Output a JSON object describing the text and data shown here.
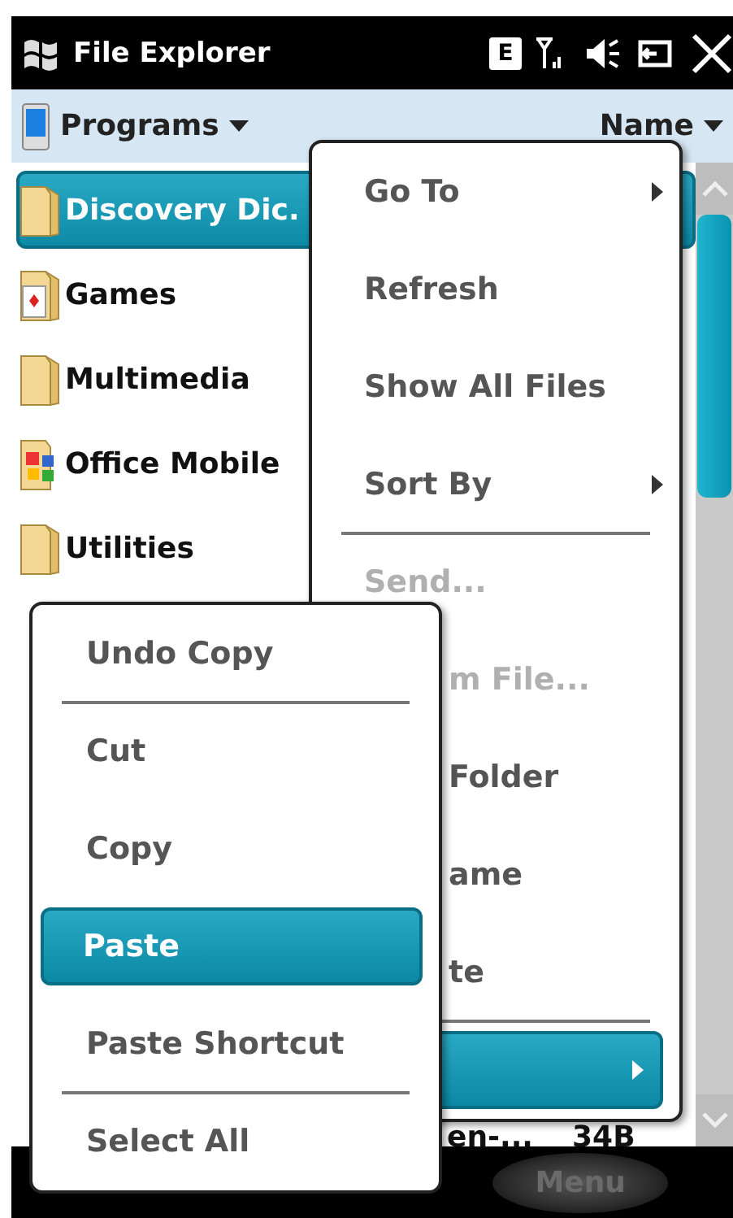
{
  "title_bar": {
    "title": "File Explorer",
    "status_letter": "E"
  },
  "toolbar": {
    "location": "Programs",
    "sort": "Name"
  },
  "files": [
    {
      "name": "Discovery Dic.",
      "kind": "folder",
      "selected": true
    },
    {
      "name": "Games",
      "kind": "games",
      "selected": false
    },
    {
      "name": "Multimedia",
      "kind": "folder",
      "selected": false
    },
    {
      "name": "Office Mobile",
      "kind": "office",
      "selected": false
    },
    {
      "name": "Utilities",
      "kind": "folder",
      "selected": false
    }
  ],
  "covered_file": {
    "name": "en-...",
    "size": "34B"
  },
  "context_menu": [
    {
      "kind": "item",
      "label": "Go To",
      "submenu": true,
      "disabled": false,
      "selected": false,
      "partial": false
    },
    {
      "kind": "item",
      "label": "Refresh",
      "submenu": false,
      "disabled": false,
      "selected": false,
      "partial": false
    },
    {
      "kind": "item",
      "label": "Show All Files",
      "submenu": false,
      "disabled": false,
      "selected": false,
      "partial": false
    },
    {
      "kind": "item",
      "label": "Sort By",
      "submenu": true,
      "disabled": false,
      "selected": false,
      "partial": false
    },
    {
      "kind": "separator"
    },
    {
      "kind": "item",
      "label": "Send...",
      "submenu": false,
      "disabled": true,
      "selected": false,
      "partial": false
    },
    {
      "kind": "item",
      "label": "m File...",
      "submenu": false,
      "disabled": true,
      "selected": false,
      "partial": true
    },
    {
      "kind": "item",
      "label": "Folder",
      "submenu": false,
      "disabled": false,
      "selected": false,
      "partial": true
    },
    {
      "kind": "item",
      "label": "ame",
      "submenu": false,
      "disabled": false,
      "selected": false,
      "partial": true
    },
    {
      "kind": "item",
      "label": "te",
      "submenu": false,
      "disabled": false,
      "selected": false,
      "partial": true
    },
    {
      "kind": "separator"
    },
    {
      "kind": "item",
      "submenu": true,
      "disabled": false,
      "selected": true,
      "partial": true
    }
  ],
  "edit_menu": [
    {
      "kind": "item",
      "label": "Undo Copy",
      "selected": false
    },
    {
      "kind": "separator"
    },
    {
      "kind": "item",
      "label": "Cut",
      "selected": false
    },
    {
      "kind": "item",
      "label": "Copy",
      "selected": false
    },
    {
      "kind": "item",
      "label": "Paste",
      "selected": true
    },
    {
      "kind": "item",
      "label": "Paste Shortcut",
      "selected": false
    },
    {
      "kind": "separator"
    },
    {
      "kind": "item",
      "label": "Select All",
      "selected": false
    }
  ],
  "softkeys": {
    "right": "Menu"
  }
}
